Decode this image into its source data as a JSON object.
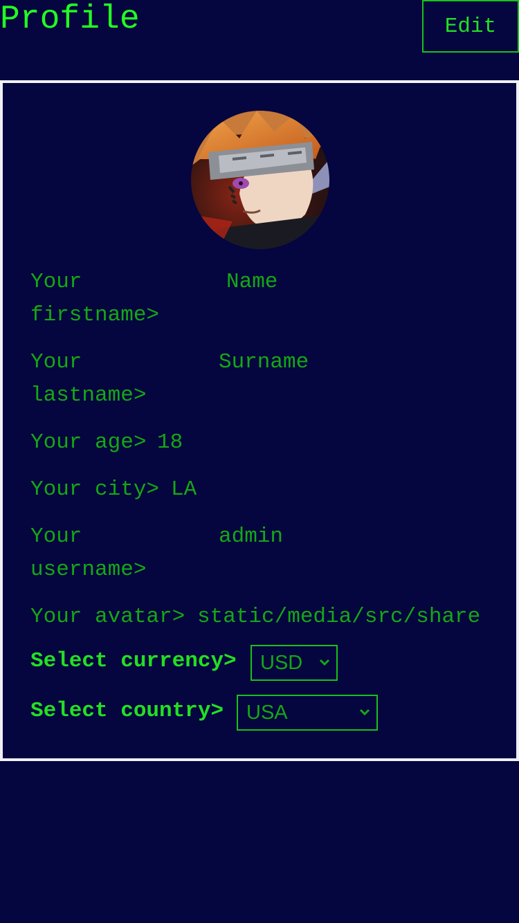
{
  "header": {
    "title": "Profile",
    "edit_label": "Edit"
  },
  "profile": {
    "avatar_icon": "anime-character-avatar",
    "fields": {
      "firstname_label": "Your firstname>",
      "firstname_value": "Name",
      "lastname_label": "Your lastname>",
      "lastname_value": "Surname",
      "age_label": "Your age>",
      "age_value": "18",
      "city_label": "Your city>",
      "city_value": "LA",
      "username_label": "Your username>",
      "username_value": "admin",
      "avatar_label": "Your avatar>",
      "avatar_value": "static/media/src/share"
    },
    "currency": {
      "label": "Select currency>",
      "selected": "USD"
    },
    "country": {
      "label": "Select country>",
      "selected": "USA"
    }
  },
  "colors": {
    "background": "#05053f",
    "accent_green": "#22ff22",
    "text_green": "#14a814",
    "card_border": "#eef0f4"
  }
}
